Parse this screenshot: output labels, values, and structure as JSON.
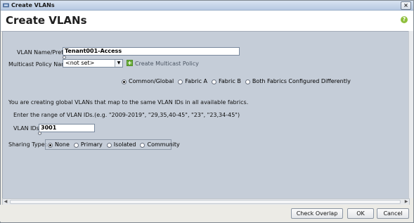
{
  "window": {
    "title": "Create VLANs",
    "close_symbol": "×"
  },
  "header": {
    "page_title": "Create VLANs",
    "help_symbol": "?"
  },
  "form": {
    "vlan_name_label": "VLAN Name/Prefix:",
    "vlan_name_value": "Tenant001-Access",
    "multicast_label": "Multicast Policy Name:",
    "multicast_value": "<not set>",
    "create_multicast_label": "Create Multicast Policy",
    "fabric_options": [
      {
        "label": "Common/Global",
        "selected": true
      },
      {
        "label": "Fabric A",
        "selected": false
      },
      {
        "label": "Fabric B",
        "selected": false
      },
      {
        "label": "Both Fabrics Configured Differently",
        "selected": false
      }
    ],
    "global_note": "You are creating global VLANs that map to the same VLAN IDs in all available fabrics.",
    "range_hint": "Enter the range of VLAN IDs.(e.g. \"2009-2019\", \"29,35,40-45\", \"23\", \"23,34-45\")",
    "vlan_ids_label": "VLAN IDs:",
    "vlan_ids_value": "3001",
    "sharing_label": "Sharing Type:",
    "sharing_options": [
      {
        "label": "None",
        "selected": true
      },
      {
        "label": "Primary",
        "selected": false
      },
      {
        "label": "Isolated",
        "selected": false
      },
      {
        "label": "Community",
        "selected": false
      }
    ]
  },
  "footer": {
    "check_overlap": "Check Overlap",
    "ok": "OK",
    "cancel": "Cancel"
  },
  "icons": {
    "window": "vlan-network-icon",
    "help": "help-icon",
    "add": "plus-icon",
    "dropdown": "chevron-down-icon"
  },
  "colors": {
    "content_bg": "#c5cdd8",
    "help_green": "#8fbf3c",
    "add_green": "#6aae3a"
  }
}
